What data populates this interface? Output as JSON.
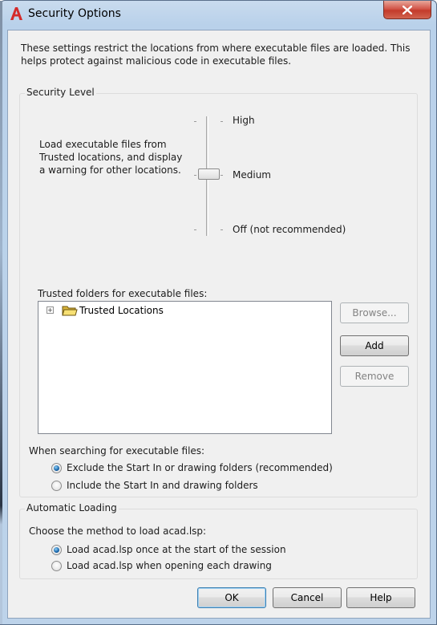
{
  "window": {
    "title": "Security Options",
    "close_symbol": "✕"
  },
  "intro": "These settings restrict the locations from where executable files are loaded.  This helps protect against malicious code in executable files.",
  "security_level": {
    "legend": "Security Level",
    "description": "Load executable files from Trusted locations, and display a warning for other locations.",
    "levels": [
      "High",
      "Medium",
      "Off (not recommended)"
    ],
    "selected": "Medium"
  },
  "trusted": {
    "label": "Trusted folders for executable files:",
    "tree_item": "Trusted Locations",
    "expander": "+",
    "buttons": {
      "browse": "Browse...",
      "add": "Add",
      "remove": "Remove"
    }
  },
  "search": {
    "label": "When searching for executable files:",
    "options": [
      "Exclude the Start In or drawing folders (recommended)",
      "Include the Start In and drawing folders"
    ],
    "selected_index": 0
  },
  "auto_loading": {
    "legend": "Automatic Loading",
    "label": "Choose the method to load acad.lsp:",
    "options": [
      "Load acad.lsp once at the start of the session",
      "Load acad.lsp when opening each drawing"
    ],
    "selected_index": 0
  },
  "footer": {
    "ok": "OK",
    "cancel": "Cancel",
    "help": "Help"
  },
  "colors": {
    "accent": "#1663a8",
    "close_button": "#c94736",
    "app_icon": "#d42b2b"
  }
}
